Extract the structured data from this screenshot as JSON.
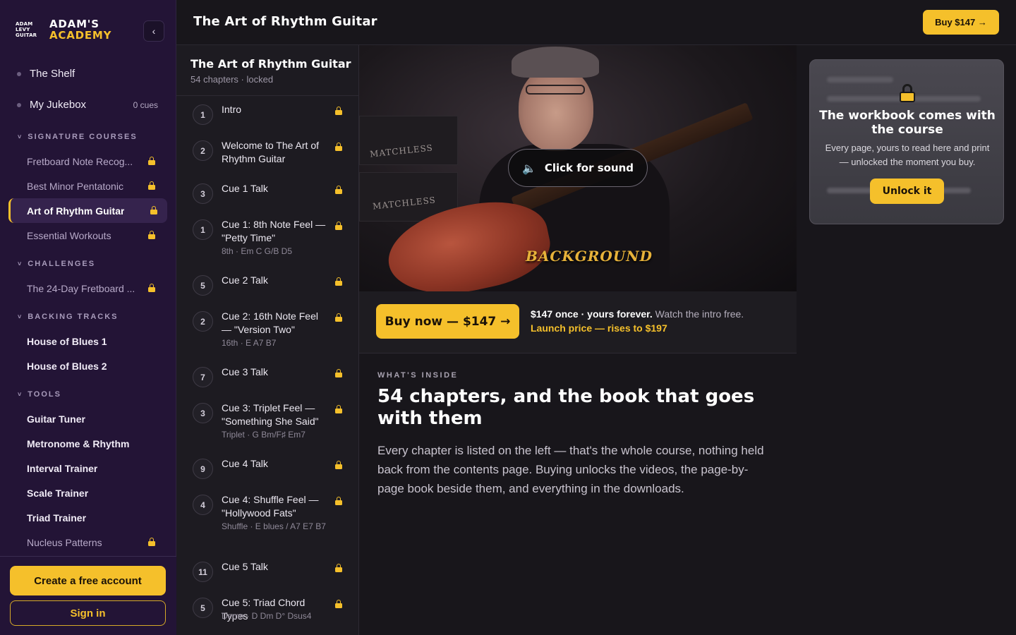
{
  "brand": {
    "mark": [
      "ADAM",
      "LEVY",
      "GUITAR"
    ],
    "line1": "ADAM'S",
    "line2": "ACADEMY",
    "collapse_glyph": "‹"
  },
  "nav_top": [
    {
      "label": "The Shelf",
      "meta": ""
    },
    {
      "label": "My Jukebox",
      "meta": "0 cues"
    }
  ],
  "sections": {
    "signature": {
      "title": "SIGNATURE COURSES",
      "items": [
        {
          "label": "Fretboard Note Recog...",
          "locked": true
        },
        {
          "label": "Best Minor Pentatonic",
          "locked": true
        },
        {
          "label": "Art of Rhythm Guitar",
          "locked": true,
          "active": true
        },
        {
          "label": "Essential Workouts",
          "locked": true
        }
      ]
    },
    "challenges": {
      "title": "CHALLENGES",
      "items": [
        {
          "label": "The 24-Day Fretboard ...",
          "locked": true
        }
      ]
    },
    "backing": {
      "title": "BACKING TRACKS",
      "items": [
        {
          "label": "House of Blues 1"
        },
        {
          "label": "House of Blues 2"
        }
      ]
    },
    "tools": {
      "title": "TOOLS",
      "items": [
        {
          "label": "Guitar Tuner"
        },
        {
          "label": "Metronome & Rhythm"
        },
        {
          "label": "Interval Trainer"
        },
        {
          "label": "Scale Trainer"
        },
        {
          "label": "Triad Trainer"
        },
        {
          "label": "Nucleus Patterns",
          "locked": true
        }
      ]
    }
  },
  "sidebar_footer": {
    "create": "Create a free account",
    "signin": "Sign in"
  },
  "topbar": {
    "title": "The Art of Rhythm Guitar",
    "buy": "Buy $147 →"
  },
  "chapter_list": {
    "title": "The Art of Rhythm Guitar",
    "subtitle": "54 chapters · locked",
    "items": [
      {
        "num": "1",
        "name": "Intro",
        "sub": ""
      },
      {
        "num": "2",
        "name": "Welcome to The Art of Rhythm Guitar",
        "sub": ""
      },
      {
        "num": "3",
        "name": "Cue 1 Talk",
        "sub": ""
      },
      {
        "num": "1",
        "name": "Cue 1: 8th Note Feel — \"Petty Time\"",
        "sub": "8th · Em C G/B D5"
      },
      {
        "num": "5",
        "name": "Cue 2 Talk",
        "sub": ""
      },
      {
        "num": "2",
        "name": "Cue 2: 16th Note Feel — \"Version Two\"",
        "sub": "16th · E A7 B7"
      },
      {
        "num": "7",
        "name": "Cue 3 Talk",
        "sub": ""
      },
      {
        "num": "3",
        "name": "Cue 3: Triplet Feel — \"Something She Said\"",
        "sub": "Triplet · G Bm/F♯ Em7"
      },
      {
        "num": "9",
        "name": "Cue 4 Talk",
        "sub": ""
      },
      {
        "num": "4",
        "name": "Cue 4: Shuffle Feel — \"Hollywood Fats\"",
        "sub": "Shuffle · E blues / A7 E7 B7"
      },
      {
        "num": "11",
        "name": "Cue 5 Talk",
        "sub": ""
      },
      {
        "num": "5",
        "name": "Cue 5: Triad Chord Types",
        "sub": "Demo · D Dm D° Dsus4"
      }
    ]
  },
  "video": {
    "sound_label": "Click for sound",
    "speaker_icon": "🔈",
    "amp_labels": [
      "MATCHLESS",
      "MATCHLESS"
    ],
    "overlay_word": "BACKGROUND"
  },
  "buy_strip": {
    "button": "Buy now — $147 →",
    "price_bold": "$147 once · yours forever.",
    "price_rest": " Watch the intro free.",
    "launch": "Launch price — rises to $197"
  },
  "inside": {
    "eyebrow": "WHAT'S INSIDE",
    "headline": "54 chapters, and the book that goes with them",
    "paragraph": "Every chapter is listed on the left — that's the whole course, nothing held back from the contents page. Buying unlocks the videos, the page-by-page book beside them, and everything in the downloads."
  },
  "workbook": {
    "title": "The workbook comes with the course",
    "desc": "Every page, yours to read here and print — unlocked the moment you buy.",
    "button": "Unlock it"
  },
  "colors": {
    "accent": "#f5c02b",
    "sidebar_bg": "#231436",
    "page_bg": "#18161b"
  }
}
